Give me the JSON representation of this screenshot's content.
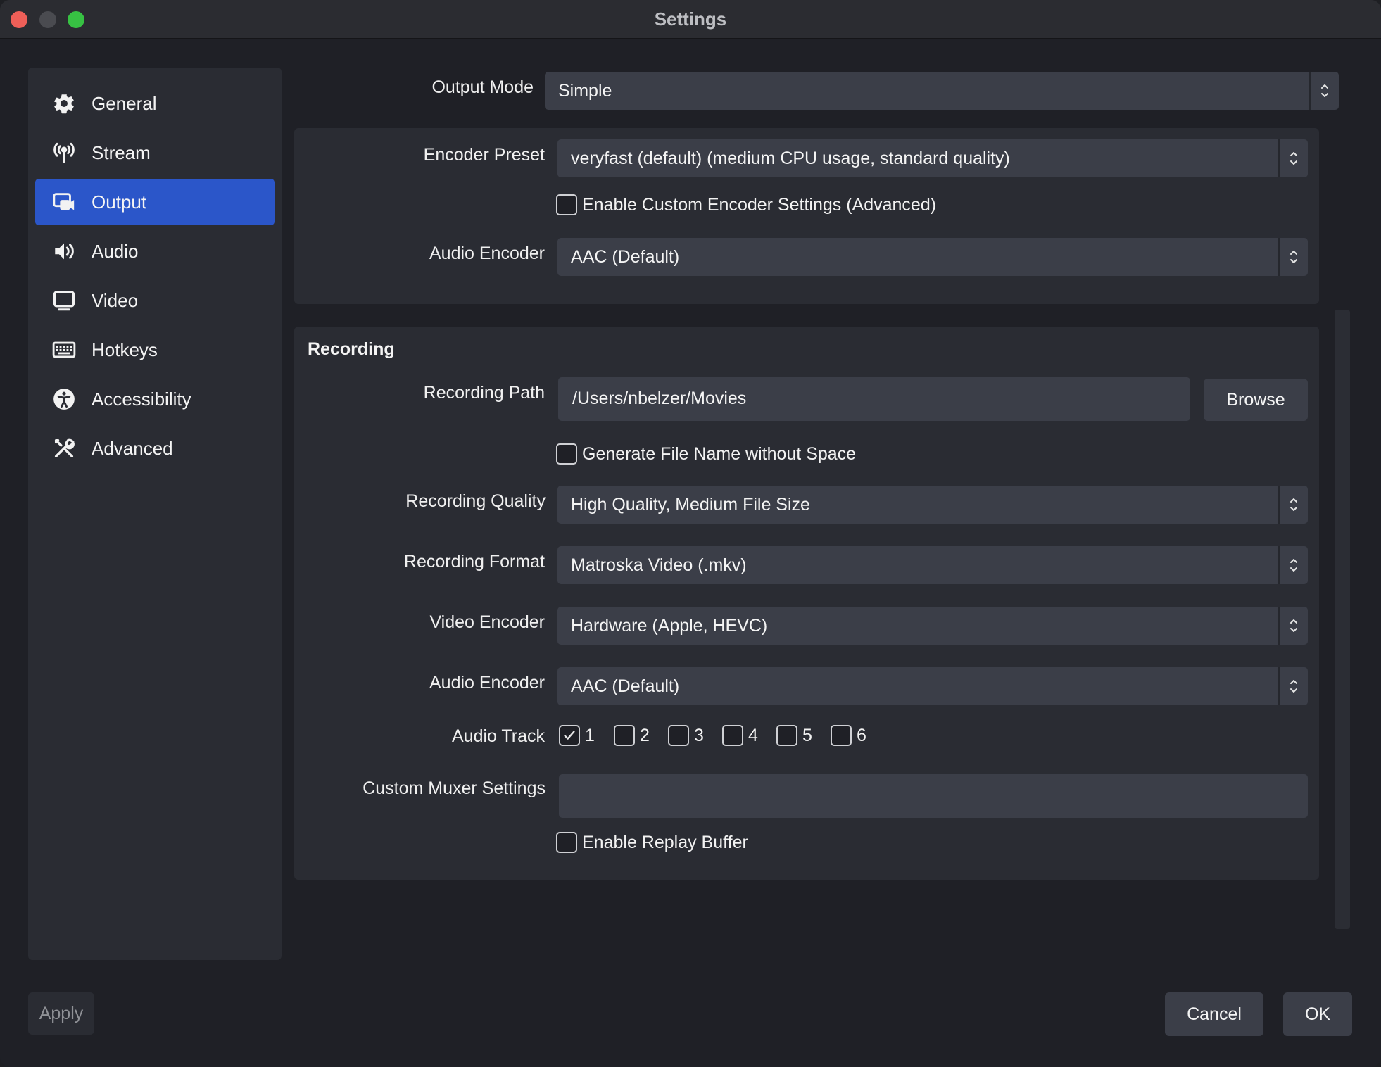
{
  "window": {
    "title": "Settings"
  },
  "sidebar": {
    "items": [
      {
        "label": "General",
        "icon": "gear-icon"
      },
      {
        "label": "Stream",
        "icon": "antenna-icon"
      },
      {
        "label": "Output",
        "icon": "output-icon",
        "active": true
      },
      {
        "label": "Audio",
        "icon": "speaker-icon"
      },
      {
        "label": "Video",
        "icon": "monitor-icon"
      },
      {
        "label": "Hotkeys",
        "icon": "keyboard-icon"
      },
      {
        "label": "Accessibility",
        "icon": "accessibility-icon"
      },
      {
        "label": "Advanced",
        "icon": "tools-icon"
      }
    ]
  },
  "output": {
    "output_mode": {
      "label": "Output Mode",
      "value": "Simple"
    },
    "streaming": {
      "encoder_preset": {
        "label": "Encoder Preset",
        "value": "veryfast (default) (medium CPU usage, standard quality)"
      },
      "custom_encoder": {
        "label": "Enable Custom Encoder Settings (Advanced)",
        "checked": false
      },
      "audio_encoder": {
        "label": "Audio Encoder",
        "value": "AAC (Default)"
      }
    },
    "recording": {
      "title": "Recording",
      "path": {
        "label": "Recording Path",
        "value": "/Users/nbelzer/Movies",
        "browse_label": "Browse"
      },
      "no_space": {
        "label": "Generate File Name without Space",
        "checked": false
      },
      "quality": {
        "label": "Recording Quality",
        "value": "High Quality, Medium File Size"
      },
      "format": {
        "label": "Recording Format",
        "value": "Matroska Video (.mkv)"
      },
      "video_encoder": {
        "label": "Video Encoder",
        "value": "Hardware (Apple, HEVC)"
      },
      "audio_encoder": {
        "label": "Audio Encoder",
        "value": "AAC (Default)"
      },
      "audio_track": {
        "label": "Audio Track",
        "tracks": [
          {
            "label": "1",
            "checked": true
          },
          {
            "label": "2",
            "checked": false
          },
          {
            "label": "3",
            "checked": false
          },
          {
            "label": "4",
            "checked": false
          },
          {
            "label": "5",
            "checked": false
          },
          {
            "label": "6",
            "checked": false
          }
        ]
      },
      "muxer": {
        "label": "Custom Muxer Settings",
        "value": ""
      },
      "replay_buffer": {
        "label": "Enable Replay Buffer",
        "checked": false
      }
    }
  },
  "footer": {
    "apply_label": "Apply",
    "cancel_label": "Cancel",
    "ok_label": "OK"
  },
  "colors": {
    "accent": "#2b56c9",
    "panel": "#2a2c33",
    "field": "#3b3e48",
    "background": "#1f2026"
  }
}
